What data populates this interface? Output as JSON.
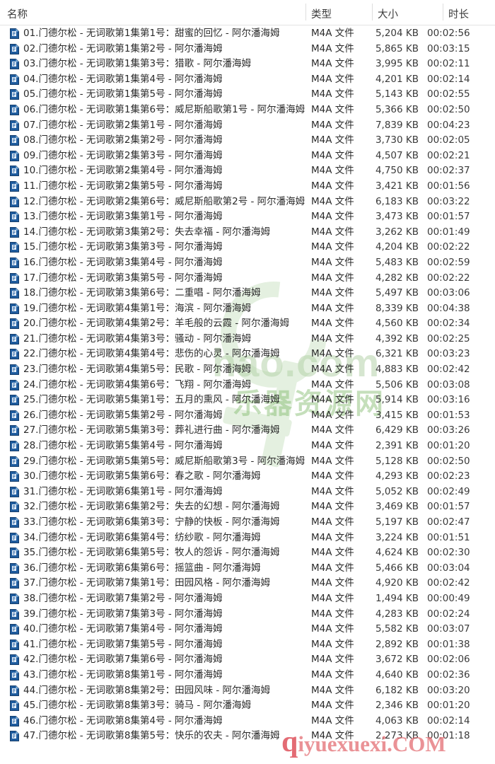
{
  "window": {
    "view": "details-list",
    "accent": "#1a5fa8"
  },
  "columns": {
    "name": "名称",
    "type": "类型",
    "size": "大小",
    "duration": "时长"
  },
  "watermarks": {
    "center_latin": "hao.com",
    "center_cn": "乐器资源网",
    "bottom_q": "q",
    "bottom_rest": "iyuexuexi.COM"
  },
  "icon": "m4a-file-icon",
  "files": [
    {
      "name": "01.门德尔松 - 无词歌第1集第1号：甜蜜的回忆 - 阿尔潘海姆",
      "type": "M4A 文件",
      "size": "5,204 KB",
      "duration": "00:02:56"
    },
    {
      "name": "02.门德尔松 - 无词歌第1集第2号 - 阿尔潘海姆",
      "type": "M4A 文件",
      "size": "5,865 KB",
      "duration": "00:03:15"
    },
    {
      "name": "03.门德尔松 - 无词歌第1集第3号：猎歌 - 阿尔潘海姆",
      "type": "M4A 文件",
      "size": "3,995 KB",
      "duration": "00:02:11"
    },
    {
      "name": "04.门德尔松 - 无词歌第1集第4号 - 阿尔潘海姆",
      "type": "M4A 文件",
      "size": "4,201 KB",
      "duration": "00:02:14"
    },
    {
      "name": "05.门德尔松 - 无词歌第1集第5号 - 阿尔潘海姆",
      "type": "M4A 文件",
      "size": "5,143 KB",
      "duration": "00:02:55"
    },
    {
      "name": "06.门德尔松 - 无词歌第1集第6号：威尼斯船歌第1号 - 阿尔潘海姆",
      "type": "M4A 文件",
      "size": "5,366 KB",
      "duration": "00:02:50"
    },
    {
      "name": "07.门德尔松 - 无词歌第2集第1号 - 阿尔潘海姆",
      "type": "M4A 文件",
      "size": "7,839 KB",
      "duration": "00:04:23"
    },
    {
      "name": "08.门德尔松 - 无词歌第2集第2号 - 阿尔潘海姆",
      "type": "M4A 文件",
      "size": "3,730 KB",
      "duration": "00:02:05"
    },
    {
      "name": "09.门德尔松 - 无词歌第2集第3号 - 阿尔潘海姆",
      "type": "M4A 文件",
      "size": "4,507 KB",
      "duration": "00:02:21"
    },
    {
      "name": "10.门德尔松 - 无词歌第2集第4号 - 阿尔潘海姆",
      "type": "M4A 文件",
      "size": "4,750 KB",
      "duration": "00:02:37"
    },
    {
      "name": "11.门德尔松 - 无词歌第2集第5号 - 阿尔潘海姆",
      "type": "M4A 文件",
      "size": "3,421 KB",
      "duration": "00:01:56"
    },
    {
      "name": "12.门德尔松 - 无词歌第2集第6号：威尼斯船歌第2号 - 阿尔潘海姆",
      "type": "M4A 文件",
      "size": "6,183 KB",
      "duration": "00:03:22"
    },
    {
      "name": "13.门德尔松 - 无词歌第3集第1号 - 阿尔潘海姆",
      "type": "M4A 文件",
      "size": "3,473 KB",
      "duration": "00:01:57"
    },
    {
      "name": "14.门德尔松 - 无词歌第3集第2号：失去幸福 - 阿尔潘海姆",
      "type": "M4A 文件",
      "size": "3,262 KB",
      "duration": "00:01:49"
    },
    {
      "name": "15.门德尔松 - 无词歌第3集第3号 - 阿尔潘海姆",
      "type": "M4A 文件",
      "size": "4,204 KB",
      "duration": "00:02:22"
    },
    {
      "name": "16.门德尔松 - 无词歌第3集第4号 - 阿尔潘海姆",
      "type": "M4A 文件",
      "size": "5,483 KB",
      "duration": "00:02:59"
    },
    {
      "name": "17.门德尔松 - 无词歌第3集第5号 - 阿尔潘海姆",
      "type": "M4A 文件",
      "size": "4,282 KB",
      "duration": "00:02:22"
    },
    {
      "name": "18.门德尔松 - 无词歌第3集第6号：二重唱 - 阿尔潘海姆",
      "type": "M4A 文件",
      "size": "5,497 KB",
      "duration": "00:03:06"
    },
    {
      "name": "19.门德尔松 - 无词歌第4集第1号：海滨 - 阿尔潘海姆",
      "type": "M4A 文件",
      "size": "8,339 KB",
      "duration": "00:04:38"
    },
    {
      "name": "20.门德尔松 - 无词歌第4集第2号：羊毛般的云霞 - 阿尔潘海姆",
      "type": "M4A 文件",
      "size": "4,560 KB",
      "duration": "00:02:34"
    },
    {
      "name": "21.门德尔松 - 无词歌第4集第3号：骚动 - 阿尔潘海姆",
      "type": "M4A 文件",
      "size": "4,392 KB",
      "duration": "00:02:25"
    },
    {
      "name": "22.门德尔松 - 无词歌第4集第4号：悲伤的心灵 - 阿尔潘海姆",
      "type": "M4A 文件",
      "size": "6,321 KB",
      "duration": "00:03:23"
    },
    {
      "name": "23.门德尔松 - 无词歌第4集第5号：民歌 - 阿尔潘海姆",
      "type": "M4A 文件",
      "size": "4,883 KB",
      "duration": "00:02:42"
    },
    {
      "name": "24.门德尔松 - 无词歌第4集第6号：飞翔 - 阿尔潘海姆",
      "type": "M4A 文件",
      "size": "5,506 KB",
      "duration": "00:03:08"
    },
    {
      "name": "25.门德尔松 - 无词歌第5集第1号：五月的熏风 - 阿尔潘海姆",
      "type": "M4A 文件",
      "size": "5,914 KB",
      "duration": "00:03:16"
    },
    {
      "name": "26.门德尔松 - 无词歌第5集第2号 - 阿尔潘海姆",
      "type": "M4A 文件",
      "size": "3,415 KB",
      "duration": "00:01:53"
    },
    {
      "name": "27.门德尔松 - 无词歌第5集第3号：葬礼进行曲 - 阿尔潘海姆",
      "type": "M4A 文件",
      "size": "6,429 KB",
      "duration": "00:03:26"
    },
    {
      "name": "28.门德尔松 - 无词歌第5集第4号 - 阿尔潘海姆",
      "type": "M4A 文件",
      "size": "2,391 KB",
      "duration": "00:01:20"
    },
    {
      "name": "29.门德尔松 - 无词歌第5集第5号：威尼斯船歌第3号 - 阿尔潘海姆",
      "type": "M4A 文件",
      "size": "5,128 KB",
      "duration": "00:02:50"
    },
    {
      "name": "30.门德尔松 - 无词歌第5集第6号：春之歌 - 阿尔潘海姆",
      "type": "M4A 文件",
      "size": "4,293 KB",
      "duration": "00:02:23"
    },
    {
      "name": "31.门德尔松 - 无词歌第6集第1号 - 阿尔潘海姆",
      "type": "M4A 文件",
      "size": "5,052 KB",
      "duration": "00:02:49"
    },
    {
      "name": "32.门德尔松 - 无词歌第6集第2号：失去的幻想 - 阿尔潘海姆",
      "type": "M4A 文件",
      "size": "3,469 KB",
      "duration": "00:01:57"
    },
    {
      "name": "33.门德尔松 - 无词歌第6集第3号：宁静的快板 - 阿尔潘海姆",
      "type": "M4A 文件",
      "size": "5,197 KB",
      "duration": "00:02:47"
    },
    {
      "name": "34.门德尔松 - 无词歌第6集第4号：纺纱歌 - 阿尔潘海姆",
      "type": "M4A 文件",
      "size": "3,224 KB",
      "duration": "00:01:51"
    },
    {
      "name": "35.门德尔松 - 无词歌第6集第5号：牧人的怨诉 - 阿尔潘海姆",
      "type": "M4A 文件",
      "size": "4,624 KB",
      "duration": "00:02:30"
    },
    {
      "name": "36.门德尔松 - 无词歌第6集第6号：摇篮曲 - 阿尔潘海姆",
      "type": "M4A 文件",
      "size": "5,466 KB",
      "duration": "00:03:04"
    },
    {
      "name": "37.门德尔松 - 无词歌第7集第1号：田园风格 - 阿尔潘海姆",
      "type": "M4A 文件",
      "size": "4,920 KB",
      "duration": "00:02:42"
    },
    {
      "name": "38.门德尔松 - 无词歌第7集第2号 - 阿尔潘海姆",
      "type": "M4A 文件",
      "size": "1,494 KB",
      "duration": "00:00:49"
    },
    {
      "name": "39.门德尔松 - 无词歌第7集第3号 - 阿尔潘海姆",
      "type": "M4A 文件",
      "size": "4,283 KB",
      "duration": "00:02:24"
    },
    {
      "name": "40.门德尔松 - 无词歌第7集第4号 - 阿尔潘海姆",
      "type": "M4A 文件",
      "size": "5,582 KB",
      "duration": "00:03:07"
    },
    {
      "name": "41.门德尔松 - 无词歌第7集第5号 - 阿尔潘海姆",
      "type": "M4A 文件",
      "size": "2,892 KB",
      "duration": "00:01:38"
    },
    {
      "name": "42.门德尔松 - 无词歌第7集第6号 - 阿尔潘海姆",
      "type": "M4A 文件",
      "size": "3,672 KB",
      "duration": "00:02:06"
    },
    {
      "name": "43.门德尔松 - 无词歌第8集第1号 - 阿尔潘海姆",
      "type": "M4A 文件",
      "size": "4,640 KB",
      "duration": "00:02:36"
    },
    {
      "name": "44.门德尔松 - 无词歌第8集第2号：田园风味 - 阿尔潘海姆",
      "type": "M4A 文件",
      "size": "6,182 KB",
      "duration": "00:03:20"
    },
    {
      "name": "45.门德尔松 - 无词歌第8集第3号：骑马 - 阿尔潘海姆",
      "type": "M4A 文件",
      "size": "2,346 KB",
      "duration": "00:01:20"
    },
    {
      "name": "46.门德尔松 - 无词歌第8集第4号 - 阿尔潘海姆",
      "type": "M4A 文件",
      "size": "4,063 KB",
      "duration": "00:02:14"
    },
    {
      "name": "47.门德尔松 - 无词歌第8集第5号：快乐的农夫 - 阿尔潘海姆",
      "type": "M4A 文件",
      "size": "2,273 KB",
      "duration": "00:01:18"
    }
  ]
}
